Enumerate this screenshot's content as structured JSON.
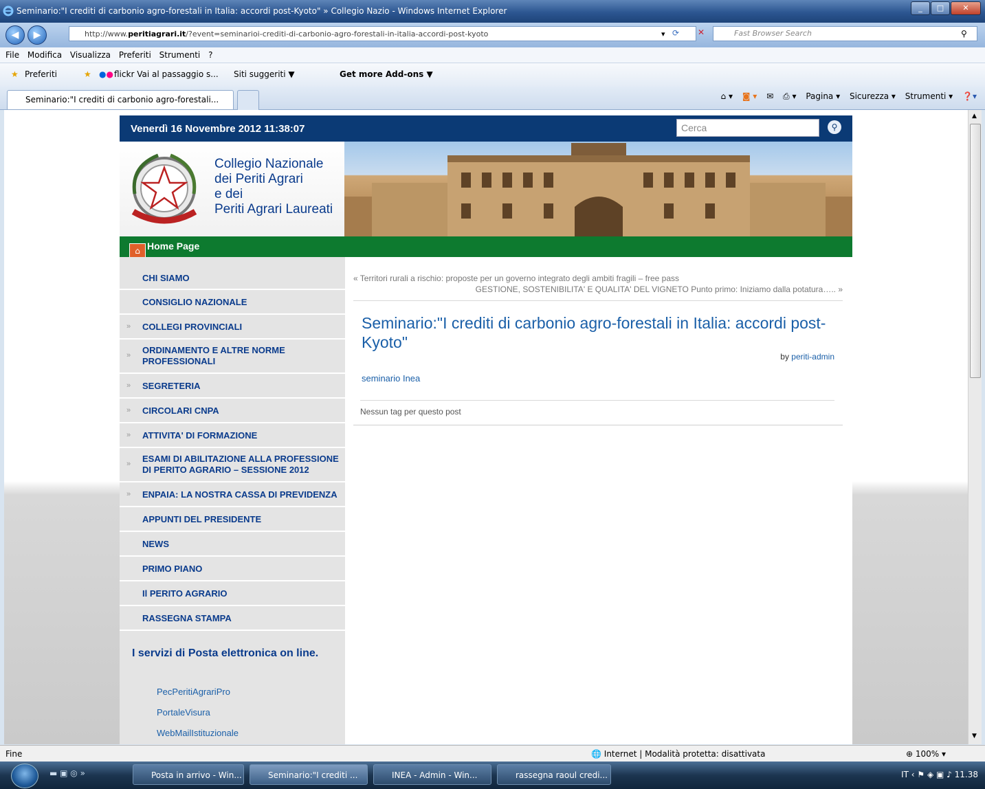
{
  "window": {
    "title": "Seminario:\"I crediti di carbonio agro-forestali in Italia: accordi post-Kyoto\" » Collegio Nazio - Windows Internet Explorer"
  },
  "address": {
    "url_prefix": "http://www.",
    "url_domain": "peritiagrari.it",
    "url_path": "/?event=seminarioi-crediti-di-carbonio-agro-forestali-in-italia-accordi-post-kyoto",
    "search_placeholder": "Fast Browser Search"
  },
  "menu": [
    "File",
    "Modifica",
    "Visualizza",
    "Preferiti",
    "Strumenti",
    "?"
  ],
  "favorites": {
    "preferiti": "Preferiti",
    "flickr": "flickr Vai al passaggio s...",
    "siti": "Siti suggeriti ▼",
    "addons": "Get more Add-ons ▼"
  },
  "tab": {
    "label": "Seminario:\"I crediti di carbonio agro-forestali..."
  },
  "commandbar": {
    "pagina": "Pagina ▾",
    "sicurezza": "Sicurezza ▾",
    "strumenti": "Strumenti ▾"
  },
  "site": {
    "date": "Venerdì 16 Novembre 2012 11:38:07",
    "search_placeholder": "Cerca",
    "org_line1": "Collegio Nazionale",
    "org_line2": "dei Periti Agrari",
    "org_line3": "e dei",
    "org_line4": "Periti Agrari Laureati",
    "home": "Home Page",
    "nav": [
      {
        "label": "CHI SIAMO",
        "arrow": ""
      },
      {
        "label": "CONSIGLIO NAZIONALE",
        "arrow": ""
      },
      {
        "label": "COLLEGI PROVINCIALI",
        "arrow": "»"
      },
      {
        "label": "ORDINAMENTO E ALTRE NORME PROFESSIONALI",
        "arrow": "»"
      },
      {
        "label": "SEGRETERIA",
        "arrow": "»"
      },
      {
        "label": "CIRCOLARI CNPA",
        "arrow": "»"
      },
      {
        "label": "ATTIVITA' DI FORMAZIONE",
        "arrow": "»"
      },
      {
        "label": "ESAMI DI ABILITAZIONE ALLA PROFESSIONE DI PERITO AGRARIO – SESSIONE 2012",
        "arrow": "»"
      },
      {
        "label": "ENPAIA: LA NOSTRA CASSA DI PREVIDENZA",
        "arrow": "»"
      },
      {
        "label": "APPUNTI DEL PRESIDENTE",
        "arrow": ""
      },
      {
        "label": "NEWS",
        "arrow": ""
      },
      {
        "label": "PRIMO PIANO",
        "arrow": ""
      },
      {
        "label": "Il PERITO AGRARIO",
        "arrow": ""
      },
      {
        "label": "RASSEGNA STAMPA",
        "arrow": ""
      }
    ],
    "mail_heading": "I servizi di Posta elettronica on line.",
    "mail_links": [
      "PecPeritiAgrariPro",
      "PortaleVisura",
      "WebMailIstituzionale"
    ],
    "prev": "« Territori rurali a rischio: proposte per un governo integrato degli ambiti fragili – free pass",
    "next": "GESTIONE, SOSTENIBILITA' E QUALITA' DEL VIGNETO Punto primo: Iniziamo dalla potatura….. »",
    "post_title": "Seminario:\"I crediti di carbonio agro-forestali in Italia: accordi post-Kyoto\"",
    "by": "by",
    "author": "periti-admin",
    "post_link": "seminario Inea",
    "tags": "Nessun tag per questo post"
  },
  "status": {
    "left": "Fine",
    "zone": "Internet | Modalità protetta: disattivata",
    "zoom": "100%"
  },
  "taskbar": {
    "tasks": [
      "Posta in arrivo - Win...",
      "Seminario:\"I crediti ...",
      "INEA - Admin - Win...",
      "rassegna raoul credi..."
    ],
    "lang": "IT",
    "time": "11.38"
  }
}
